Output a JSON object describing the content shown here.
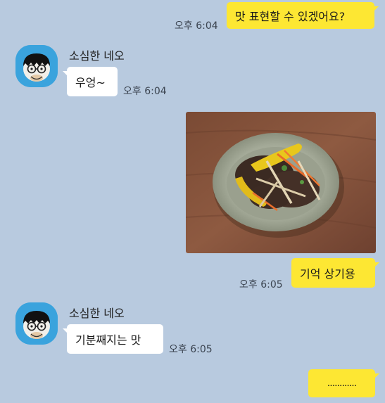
{
  "messages": [
    {
      "text": "맛 표현할 수 있겠어요?",
      "time": "오후 6:04"
    },
    {
      "sender": "소심한 네오",
      "text": "우엉~",
      "time": "오후 6:04"
    },
    {
      "photo": "food-photo",
      "text": "기억 상기용",
      "time": "오후 6:05"
    },
    {
      "sender": "소심한 네오",
      "text": "기분째지는 맛",
      "time": "오후 6:05"
    },
    {
      "text": "............"
    }
  ],
  "colors": {
    "chat_background": "#b8cadf",
    "my_bubble": "#fde733",
    "their_bubble": "#ffffff",
    "avatar_background": "#3aa3dd"
  },
  "icons": {
    "avatar": "neo-character-icon"
  }
}
